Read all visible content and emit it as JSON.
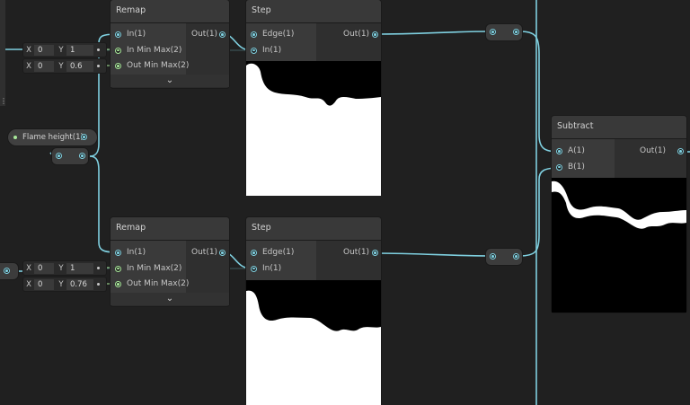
{
  "colors": {
    "wire": "#7fd0e0",
    "port_in": "#7fd0e0",
    "port_property": "#a8e89a",
    "background": "#202020"
  },
  "nodes": {
    "remap_top": {
      "title": "Remap",
      "in": "In(1)",
      "min_max": "In Min Max(2)",
      "out_min_max": "Out Min Max(2)",
      "out": "Out(1)",
      "collapse_icon": "chevron-down-icon"
    },
    "step_top": {
      "title": "Step",
      "edge": "Edge(1)",
      "in": "In(1)",
      "out": "Out(1)"
    },
    "remap_bottom": {
      "title": "Remap",
      "in": "In(1)",
      "min_max": "In Min Max(2)",
      "out_min_max": "Out Min Max(2)",
      "out": "Out(1)",
      "collapse_icon": "chevron-down-icon"
    },
    "step_bottom": {
      "title": "Step",
      "edge": "Edge(1)",
      "in": "In(1)",
      "out": "Out(1)"
    },
    "subtract": {
      "title": "Subtract",
      "a": "A(1)",
      "b": "B(1)",
      "out": "Out(1)"
    }
  },
  "vectors": {
    "top_in": {
      "x_label": "X",
      "x_value": "0",
      "y_label": "Y",
      "y_value": "1"
    },
    "top_out": {
      "x_label": "X",
      "x_value": "0",
      "y_label": "Y",
      "y_value": "0.6"
    },
    "bottom_in": {
      "x_label": "X",
      "x_value": "0",
      "y_label": "Y",
      "y_value": "1"
    },
    "bottom_out": {
      "x_label": "X",
      "x_value": "0",
      "y_label": "Y",
      "y_value": "0.76"
    }
  },
  "property": {
    "label": "Flame height(1)"
  }
}
